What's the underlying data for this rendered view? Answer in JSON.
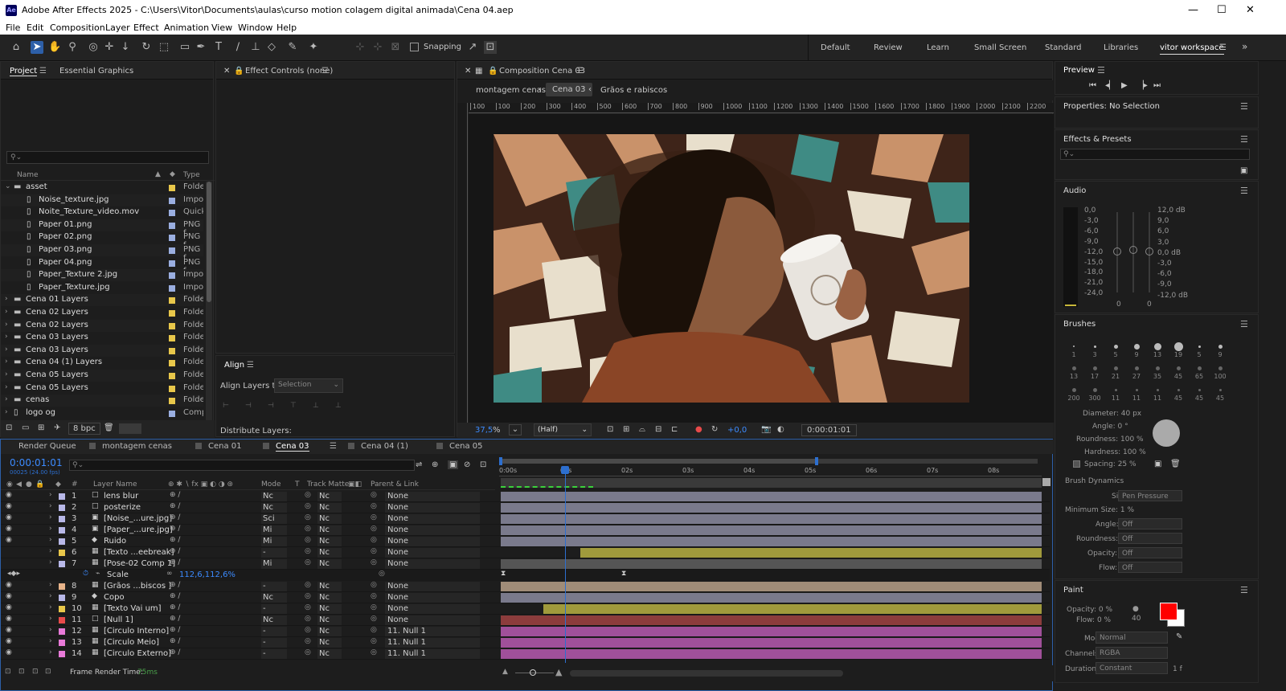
{
  "window": {
    "title": "Adobe After Effects 2025 - C:\\Users\\Vitor\\Documents\\aulas\\curso motion colagem digital animada\\Cena 04.aep",
    "icon": "Ae",
    "minimize": "—",
    "maximize": "☐",
    "close": "✕"
  },
  "menu": [
    "File",
    "Edit",
    "Composition",
    "Layer",
    "Effect",
    "Animation",
    "View",
    "Window",
    "Help"
  ],
  "toolbar": {
    "snapping": "Snapping",
    "workspaces": [
      "Default",
      "Review",
      "Learn",
      "Small Screen",
      "Standard",
      "Libraries",
      "vitor workspace"
    ],
    "more": "»"
  },
  "project": {
    "tabs": [
      "Project",
      "Essential Graphics"
    ],
    "search_placeholder": "",
    "col_name": "Name",
    "col_type": "Type",
    "bpc": "8 bpc",
    "items": [
      {
        "name": "asset",
        "type": "Folde",
        "color": "#e8c74a",
        "indent": 0,
        "folder": true,
        "open": true
      },
      {
        "name": "Noise_texture.jpg",
        "type": "Impo",
        "color": "#9aaee0",
        "indent": 1
      },
      {
        "name": "Noite_Texture_video.mov",
        "type": "Quick",
        "color": "#9aaee0",
        "indent": 1
      },
      {
        "name": "Paper 01.png",
        "type": "PNG f",
        "color": "#9aaee0",
        "indent": 1
      },
      {
        "name": "Paper 02.png",
        "type": "PNG f",
        "color": "#9aaee0",
        "indent": 1
      },
      {
        "name": "Paper 03.png",
        "type": "PNG f",
        "color": "#9aaee0",
        "indent": 1
      },
      {
        "name": "Paper 04.png",
        "type": "PNG f",
        "color": "#9aaee0",
        "indent": 1
      },
      {
        "name": "Paper_Texture 2.jpg",
        "type": "Impo",
        "color": "#9aaee0",
        "indent": 1
      },
      {
        "name": "Paper_Texture.jpg",
        "type": "Impo",
        "color": "#9aaee0",
        "indent": 1
      },
      {
        "name": "Cena 01 Layers",
        "type": "Folde",
        "color": "#e8c74a",
        "indent": 0,
        "folder": true
      },
      {
        "name": "Cena 02 Layers",
        "type": "Folde",
        "color": "#e8c74a",
        "indent": 0,
        "folder": true
      },
      {
        "name": "Cena 02 Layers",
        "type": "Folde",
        "color": "#e8c74a",
        "indent": 0,
        "folder": true
      },
      {
        "name": "Cena 03 Layers",
        "type": "Folde",
        "color": "#e8c74a",
        "indent": 0,
        "folder": true
      },
      {
        "name": "Cena 03 Layers",
        "type": "Folde",
        "color": "#e8c74a",
        "indent": 0,
        "folder": true
      },
      {
        "name": "Cena 04 (1) Layers",
        "type": "Folde",
        "color": "#e8c74a",
        "indent": 0,
        "folder": true
      },
      {
        "name": "Cena 05 Layers",
        "type": "Folde",
        "color": "#e8c74a",
        "indent": 0,
        "folder": true
      },
      {
        "name": "Cena 05 Layers",
        "type": "Folde",
        "color": "#e8c74a",
        "indent": 0,
        "folder": true
      },
      {
        "name": "cenas",
        "type": "Folde",
        "color": "#e8c74a",
        "indent": 0,
        "folder": true
      },
      {
        "name": "logo og",
        "type": "Comp",
        "color": "#9aaee0",
        "indent": 0
      }
    ]
  },
  "effect_controls": {
    "title": "Effect Controls (none)"
  },
  "align": {
    "title": "Align",
    "align_to_label": "Align Layers to:",
    "align_to_value": "Selection",
    "distribute": "Distribute Layers:"
  },
  "composition": {
    "title": "Composition Cena 03",
    "crumbs": [
      "montagem cenas",
      "Cena 03",
      "Grãos e rabiscos"
    ],
    "ruler": [
      "100",
      "100",
      "200",
      "300",
      "400",
      "500",
      "600",
      "700",
      "800",
      "900",
      "1000",
      "1100",
      "1200",
      "1300",
      "1400",
      "1500",
      "1600",
      "1700",
      "1800",
      "1900",
      "2000",
      "2100",
      "2200"
    ],
    "zoom": "37,5",
    "zoom_unit": "%",
    "resolution": "(Half)",
    "exposure": "+0,0",
    "timecode": "0:00:01:01"
  },
  "preview": {
    "title": "Preview"
  },
  "properties": {
    "title": "Properties: No Selection"
  },
  "effects_presets": {
    "title": "Effects & Presets"
  },
  "audio": {
    "title": "Audio",
    "left_scale": [
      "0,0",
      "-3,0",
      "-6,0",
      "-9,0",
      "-12,0",
      "-15,0",
      "-18,0",
      "-21,0",
      "-24,0"
    ],
    "right_scale": [
      "12,0 dB",
      "9,0",
      "6,0",
      "3,0",
      "0,0 dB",
      "-3,0",
      "-6,0",
      "-9,0",
      "-12,0 dB"
    ],
    "zero_left": "0",
    "zero_right": "0"
  },
  "brushes": {
    "title": "Brushes",
    "sizes": [
      "1",
      "3",
      "5",
      "9",
      "13",
      "19",
      "5",
      "9",
      "13",
      "17",
      "21",
      "27",
      "35",
      "45",
      "65",
      "100",
      "200",
      "300",
      "11",
      "11",
      "11",
      "45",
      "45",
      "45"
    ],
    "diameter": "Diameter: 40 px",
    "angle": "Angle: 0 °",
    "roundness": "Roundness: 100 %",
    "hardness": "Hardness: 100 %",
    "spacing": "Spacing: 25 %",
    "dynamics": "Brush Dynamics",
    "size_label": "Size:",
    "size_val": "Pen Pressure",
    "min_size": "Minimum Size: 1 %",
    "angle_label": "Angle:",
    "roundness_label": "Roundness:",
    "opacity_label": "Opacity:",
    "flow_label": "Flow:",
    "off": "Off"
  },
  "paint": {
    "title": "Paint",
    "opacity": "Opacity: 0 %",
    "flow": "Flow: 0 %",
    "n40": "40",
    "mode_label": "Mode:",
    "mode": "Normal",
    "channels_label": "Channels:",
    "channels": "RGBA",
    "duration_label": "Duration:",
    "duration": "Constant",
    "duration_extra": "1 f",
    "fg": "#ff0000",
    "bg": "#ffffff"
  },
  "timeline": {
    "tabs": [
      "Render Queue",
      "montagem cenas",
      "Cena 01",
      "Cena 03",
      "Cena 04 (1)",
      "Cena 05"
    ],
    "active_tab": "Cena 03",
    "timecode": "0:00:01:01",
    "fps": "00025 (24.00 fps)",
    "cols": {
      "layer_name": "Layer Name",
      "mode": "Mode",
      "t": "T",
      "track_matte": "Track Matte",
      "parent": "Parent & Link"
    },
    "time_marks": [
      "0:00s",
      "01s",
      "02s",
      "03s",
      "04s",
      "05s",
      "06s",
      "07s",
      "08s"
    ],
    "layers": [
      {
        "num": "1",
        "name": "lens blur",
        "color": "#b8b8e8",
        "icon": "square",
        "mode": "Nc",
        "tm": "Nc",
        "parent": "None",
        "bar": "#7a7a8c",
        "start": 0
      },
      {
        "num": "2",
        "name": "posterize",
        "color": "#b8b8e8",
        "icon": "square",
        "mode": "Nc",
        "tm": "Nc",
        "parent": "None",
        "bar": "#7a7a8c",
        "start": 0
      },
      {
        "num": "3",
        "name": "[Noise_...ure.jpg]",
        "color": "#b8b8e8",
        "icon": "img",
        "mode": "Sci",
        "tm": "Nc",
        "parent": "None",
        "bar": "#7a7a8c",
        "start": 0
      },
      {
        "num": "4",
        "name": "[Paper_...ure.jpg]",
        "color": "#b8b8e8",
        "icon": "img",
        "mode": "Mi",
        "tm": "Nc",
        "parent": "None",
        "bar": "#7a7a8c",
        "start": 0
      },
      {
        "num": "5",
        "name": "Ruido",
        "color": "#b8b8e8",
        "icon": "fx",
        "mode": "Mi",
        "tm": "Nc",
        "parent": "None",
        "bar": "#7a7a8c",
        "start": 0
      },
      {
        "num": "6",
        "name": "[Texto ...eebreak]",
        "color": "#e8c74a",
        "icon": "comp",
        "mode": "-",
        "tm": "Nc",
        "parent": "None",
        "bar": "#a09a3c",
        "start": 1.3
      },
      {
        "num": "7",
        "name": "[Pose-02 Comp 1]",
        "color": "#b8b8e8",
        "icon": "comp",
        "mode": "Mi",
        "tm": "Nc",
        "parent": "None",
        "bar": "#555",
        "start": 0
      },
      {
        "num": "8",
        "name": "[Grãos ...biscos ]",
        "color": "#e8b48a",
        "icon": "comp",
        "mode": "-",
        "tm": "Nc",
        "parent": "None",
        "bar": "#a08c78",
        "start": 0
      },
      {
        "num": "9",
        "name": "Copo",
        "color": "#b8b8e8",
        "icon": "fx",
        "mode": "Nc",
        "tm": "Nc",
        "parent": "None",
        "bar": "#7a7a8c",
        "start": 0
      },
      {
        "num": "10",
        "name": "[Texto Vai um]",
        "color": "#e8c74a",
        "icon": "comp",
        "mode": "-",
        "tm": "Nc",
        "parent": "None",
        "bar": "#a09a3c",
        "start": 0.7
      },
      {
        "num": "11",
        "name": "[Null 1]",
        "color": "#e84a4a",
        "icon": "square",
        "mode": "Nc",
        "tm": "Nc",
        "parent": "None",
        "bar": "#8c3c3c",
        "start": 0
      },
      {
        "num": "12",
        "name": "[Circulo Interno]",
        "color": "#e87ad8",
        "icon": "comp",
        "mode": "-",
        "tm": "Nc",
        "parent": "11. Null 1",
        "bar": "#a0509a",
        "start": 0
      },
      {
        "num": "13",
        "name": "[Circulo Meio]",
        "color": "#e87ad8",
        "icon": "comp",
        "mode": "-",
        "tm": "Nc",
        "parent": "11. Null 1",
        "bar": "#a0509a",
        "start": 0
      },
      {
        "num": "14",
        "name": "[Circulo Externo]",
        "color": "#e87ad8",
        "icon": "comp",
        "mode": "-",
        "tm": "Nc",
        "parent": "11. Null 1",
        "bar": "#a0509a",
        "start": 0
      }
    ],
    "scale_label": "Scale",
    "scale_value": "112,6,112,6%",
    "render_time_label": "Frame Render Time:",
    "render_time": "75ms"
  }
}
